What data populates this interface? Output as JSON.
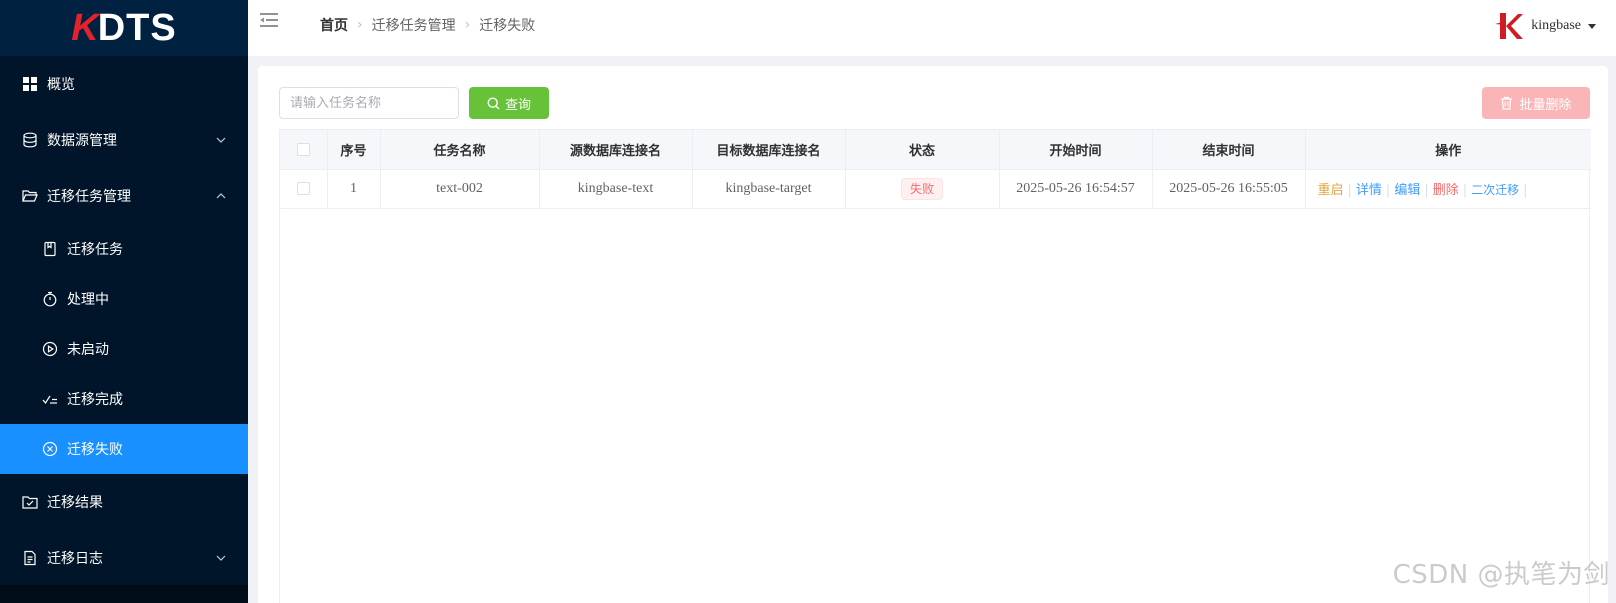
{
  "logo": {
    "k": "K",
    "rest": "DTS"
  },
  "sidebar": {
    "items": [
      {
        "label": "概览",
        "icon": "grid-icon"
      },
      {
        "label": "数据源管理",
        "icon": "database-icon",
        "arrow": "chevron-down"
      },
      {
        "label": "迁移任务管理",
        "icon": "folder-open-icon",
        "arrow": "chevron-up"
      },
      {
        "label": "迁移任务",
        "icon": "notebook-icon"
      },
      {
        "label": "处理中",
        "icon": "stopwatch-icon"
      },
      {
        "label": "未启动",
        "icon": "play-circle-icon"
      },
      {
        "label": "迁移完成",
        "icon": "check-list-icon"
      },
      {
        "label": "迁移失败",
        "icon": "close-circle-icon",
        "active": true
      },
      {
        "label": "迁移结果",
        "icon": "folder-checked-icon"
      },
      {
        "label": "迁移日志",
        "icon": "document-icon",
        "arrow": "chevron-down"
      }
    ]
  },
  "header": {
    "breadcrumb": [
      "首页",
      "迁移任务管理",
      "迁移失败"
    ],
    "username": "kingbase"
  },
  "toolbar": {
    "search_placeholder": "请输入任务名称",
    "search_value": "",
    "query_label": "查询",
    "batch_delete_label": "批量删除"
  },
  "table": {
    "columns": [
      "序号",
      "任务名称",
      "源数据库连接名",
      "目标数据库连接名",
      "状态",
      "开始时间",
      "结束时间",
      "操作"
    ],
    "rows": [
      {
        "index": "1",
        "task_name": "text-002",
        "source": "kingbase-text",
        "target": "kingbase-target",
        "status": "失败",
        "start_time": "2025-05-26 16:54:57",
        "end_time": "2025-05-26 16:55:05",
        "actions": [
          "重启",
          "详情",
          "编辑",
          "删除",
          "二次迁移"
        ]
      }
    ]
  },
  "colors": {
    "sidebar_bg": "#001529",
    "active": "#1890ff",
    "query_btn": "#67c23a",
    "batch_delete_btn": "#fab6b6",
    "action_restart": "#e6a23c",
    "action_detail": "#409eff",
    "action_edit": "#409eff",
    "action_delete": "#f56c6c",
    "action_second": "#409eff",
    "status_fail": "#f56c6c"
  },
  "watermark": "CSDN @执笔为剑"
}
